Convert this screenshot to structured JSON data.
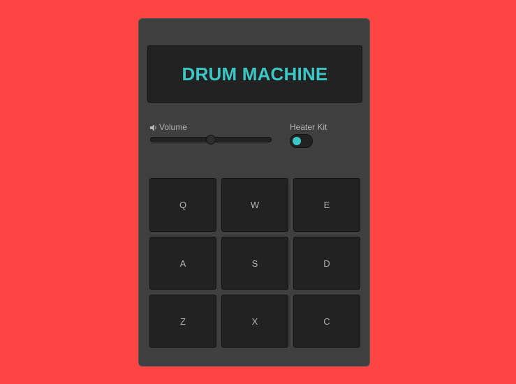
{
  "display": {
    "text": "DRUM MACHINE"
  },
  "controls": {
    "volume": {
      "label": "Volume",
      "icon": "speaker-icon",
      "value": 0.5
    },
    "bank": {
      "label": "Heater Kit",
      "on": false
    }
  },
  "pads": [
    {
      "key": "Q"
    },
    {
      "key": "W"
    },
    {
      "key": "E"
    },
    {
      "key": "A"
    },
    {
      "key": "S"
    },
    {
      "key": "D"
    },
    {
      "key": "Z"
    },
    {
      "key": "X"
    },
    {
      "key": "C"
    }
  ],
  "colors": {
    "background": "#ff4444",
    "panel": "#3f3f3f",
    "display_text": "#3cc7c7",
    "pad": "#222222",
    "toggle_knob": "#3cc7c7"
  }
}
